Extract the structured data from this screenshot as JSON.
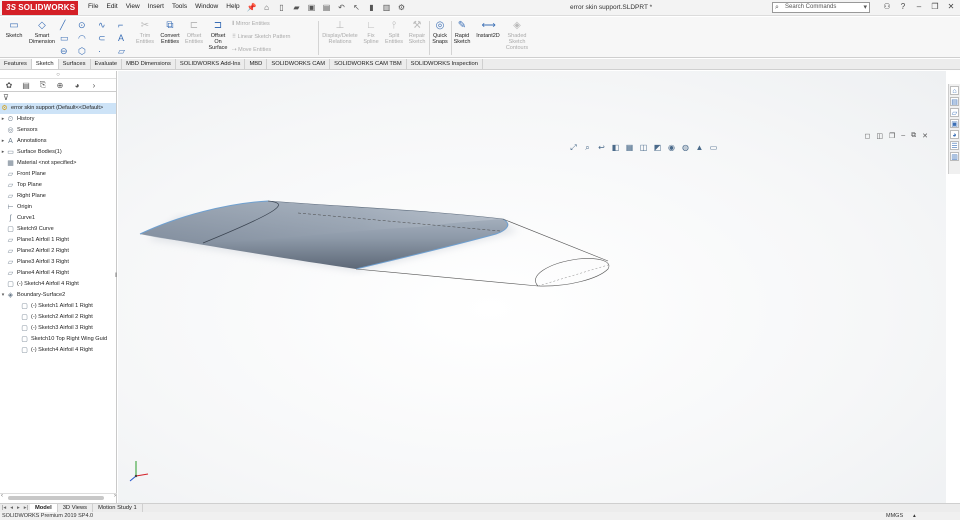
{
  "app": {
    "logo_prefix": "3S",
    "logo_text": "SOLIDWORKS",
    "document_title": "error skin support.SLDPRT *",
    "menu": [
      "File",
      "Edit",
      "View",
      "Insert",
      "Tools",
      "Window",
      "Help"
    ],
    "search_placeholder": "Search Commands"
  },
  "commands": {
    "sketch": "Sketch",
    "smart_dimension_1": "Smart",
    "smart_dimension_2": "Dimension",
    "trim_entities_1": "Trim",
    "trim_entities_2": "Entities",
    "convert_entities_1": "Convert",
    "convert_entities_2": "Entities",
    "offset_entities_1": "Offset",
    "offset_entities_2": "Entities",
    "offset_on_surface_1": "Offset",
    "offset_on_surface_2": "On",
    "offset_on_surface_3": "Surface",
    "mirror_entities": "Mirror Entities",
    "linear_sketch_pattern": "Linear Sketch Pattern",
    "move_entities": "Move Entities",
    "display_delete_relations_1": "Display/Delete",
    "display_delete_relations_2": "Relations",
    "fix_spline_1": "Fix",
    "fix_spline_2": "Spline",
    "split_entities_1": "Split",
    "split_entities_2": "Entities",
    "repair_sketch_1": "Repair",
    "repair_sketch_2": "Sketch",
    "quick_snaps_1": "Quick",
    "quick_snaps_2": "Snaps",
    "rapid_sketch_1": "Rapid",
    "rapid_sketch_2": "Sketch",
    "instant2d": "Instant2D",
    "shaded_sketch_contours_1": "Shaded",
    "shaded_sketch_contours_2": "Sketch",
    "shaded_sketch_contours_3": "Contours"
  },
  "tabs": [
    "Features",
    "Sketch",
    "Surfaces",
    "Evaluate",
    "MBD Dimensions",
    "SOLIDWORKS Add-Ins",
    "MBD",
    "SOLIDWORKS CAM",
    "SOLIDWORKS CAM TBM",
    "SOLIDWORKS Inspection"
  ],
  "active_tab": "Sketch",
  "tree": {
    "root": "error skin support  (Default<<Default>",
    "items": [
      {
        "label": "History",
        "icon": "history-icon",
        "expandable": true,
        "indent": 0
      },
      {
        "label": "Sensors",
        "icon": "sensor-icon",
        "expandable": false,
        "indent": 0
      },
      {
        "label": "Annotations",
        "icon": "annotation-icon",
        "expandable": true,
        "indent": 0
      },
      {
        "label": "Surface Bodies(1)",
        "icon": "surface-bodies-icon",
        "expandable": true,
        "indent": 0
      },
      {
        "label": "Material <not specified>",
        "icon": "material-icon",
        "expandable": false,
        "indent": 0
      },
      {
        "label": "Front Plane",
        "icon": "plane-icon",
        "expandable": false,
        "indent": 0
      },
      {
        "label": "Top Plane",
        "icon": "plane-icon",
        "expandable": false,
        "indent": 0
      },
      {
        "label": "Right Plane",
        "icon": "plane-icon",
        "expandable": false,
        "indent": 0
      },
      {
        "label": "Origin",
        "icon": "origin-icon",
        "expandable": false,
        "indent": 0
      },
      {
        "label": "Curve1",
        "icon": "curve-icon",
        "expandable": false,
        "indent": 0
      },
      {
        "label": "Sketch9 Curve",
        "icon": "sketch-icon",
        "expandable": false,
        "indent": 0
      },
      {
        "label": "Plane1 Airfoil 1 Right",
        "icon": "plane-icon",
        "expandable": false,
        "indent": 0
      },
      {
        "label": "Plane2 Airfoil 2 Right",
        "icon": "plane-icon",
        "expandable": false,
        "indent": 0
      },
      {
        "label": "Plane3 Airfoil 3 Right",
        "icon": "plane-icon",
        "expandable": false,
        "indent": 0
      },
      {
        "label": "Plane4 Airfoil 4 Right",
        "icon": "plane-icon",
        "expandable": false,
        "indent": 0
      },
      {
        "label": "(-) Sketch4 Airfoil 4 Right",
        "icon": "sketch-icon",
        "expandable": false,
        "indent": 0
      },
      {
        "label": "Boundary-Surface2",
        "icon": "boundary-surface-icon",
        "expandable": true,
        "expanded": true,
        "indent": 0
      },
      {
        "label": "(-) Sketch1 Airfoil 1 Right",
        "icon": "sketch-icon",
        "expandable": false,
        "indent": 1
      },
      {
        "label": "(-) Sketch2 Airfoil 2 Right",
        "icon": "sketch-icon",
        "expandable": false,
        "indent": 1
      },
      {
        "label": "(-) Sketch3 Airfoil 3 Right",
        "icon": "sketch-icon",
        "expandable": false,
        "indent": 1
      },
      {
        "label": "Sketch10 Top Right Wing Guid",
        "icon": "sketch-icon",
        "expandable": false,
        "indent": 1
      },
      {
        "label": "(-) Sketch4 Airfoil 4 Right",
        "icon": "sketch-icon",
        "expandable": false,
        "indent": 1
      }
    ]
  },
  "bottom_tabs": [
    "Model",
    "3D Views",
    "Motion Study 1"
  ],
  "active_bottom_tab": "Model",
  "status": {
    "product": "SOLIDWORKS Premium 2019 SP4.0",
    "units": "MMGS"
  },
  "colors": {
    "brand": "#d42027",
    "surface": "#8a96a6",
    "edge": "#6fa0d0"
  }
}
